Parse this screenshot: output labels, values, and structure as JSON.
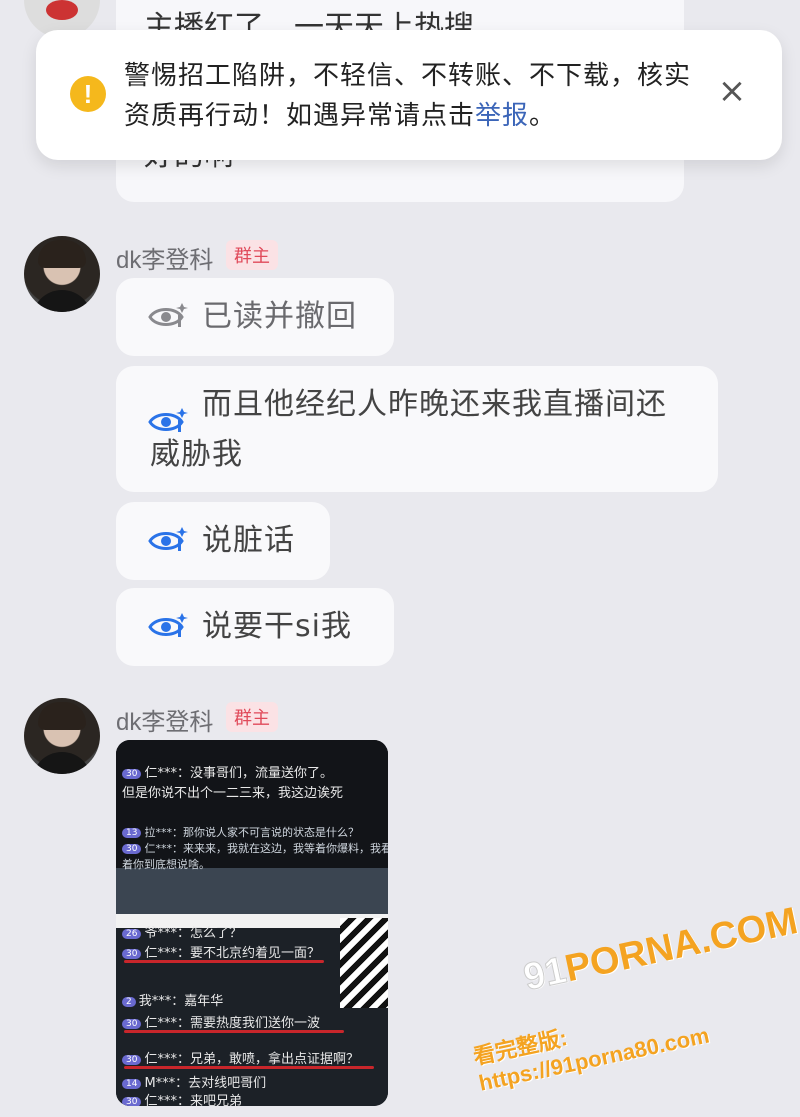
{
  "previous_message": {
    "line1": "主播红了，一天天上热搜",
    "line2": "好的啊"
  },
  "warning": {
    "text_before_link": "警惕招工陷阱，不轻信、不转账、不下载，核实资质再行动！如遇异常请点击",
    "link_label": "举报",
    "text_after_link": "。",
    "close_symbol": "×",
    "icon_symbol": "!",
    "accent_color": "#f5b81c",
    "link_color": "#3b65b8"
  },
  "messages": [
    {
      "sender": "dk李登科",
      "badge": "群主",
      "bubbles": [
        {
          "state": "read-withdrawn",
          "text": "已读并撤回",
          "icon": "eye-icon"
        },
        {
          "state": "read",
          "lines": [
            "而且他经纪人昨晚还来我直播间还",
            "威胁我"
          ],
          "icon": "eye-icon"
        },
        {
          "state": "read",
          "text": "说脏话",
          "icon": "eye-icon"
        },
        {
          "state": "read",
          "text": "说要干si我",
          "icon": "eye-icon"
        }
      ]
    },
    {
      "sender": "dk李登科",
      "badge": "群主",
      "image": {
        "top_lines": [
          {
            "level": "30",
            "text": "仁***：没事哥们，流量送你了。"
          },
          {
            "level": "",
            "text": "但是你说不出个一二三来，我这边诶死"
          }
        ],
        "mid_lines": [
          {
            "level": "13",
            "text": "拉***：那你说人家不可言说的状态是什么？"
          },
          {
            "level": "30",
            "text": "仁***：来来来，我就在这边，我等着你爆料，我看"
          },
          {
            "level": "",
            "text": "着你到底想说啥。"
          }
        ],
        "bottom_lines": [
          {
            "level": "26",
            "text": "爷***：怎么了？"
          },
          {
            "level": "30",
            "text": "仁***：要不北京约着见一面？"
          },
          {
            "level": "2",
            "text": "我***：嘉年华"
          },
          {
            "level": "30",
            "text": "仁***：需要热度我们送你一波"
          },
          {
            "level": "30",
            "text": "仁***：兄弟，敢喷，拿出点证据啊？"
          },
          {
            "level": "14",
            "text": "M***：去对线吧哥们"
          },
          {
            "level": "30",
            "text": "仁***：来吧兄弟"
          }
        ]
      }
    }
  ],
  "watermark": {
    "line1_prefix": "91",
    "line1": "PORNA.COM",
    "line2": "看完整版: https://91porna80.com"
  }
}
